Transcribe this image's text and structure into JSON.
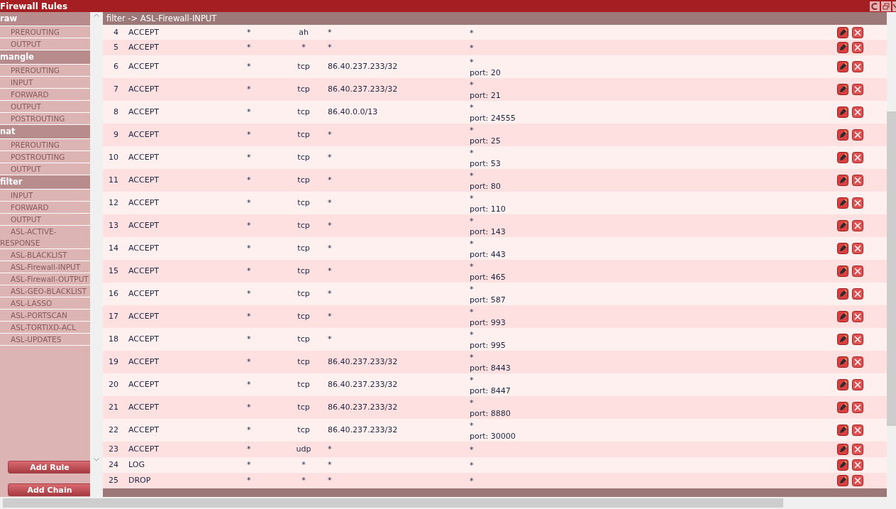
{
  "window": {
    "title": "Firewall Rules"
  },
  "sidebar": {
    "groups": [
      {
        "name": "raw",
        "items": [
          "PREROUTING",
          "OUTPUT"
        ]
      },
      {
        "name": "mangle",
        "items": [
          "PREROUTING",
          "INPUT",
          "FORWARD",
          "OUTPUT",
          "POSTROUTING"
        ]
      },
      {
        "name": "nat",
        "items": [
          "PREROUTING",
          "POSTROUTING",
          "OUTPUT"
        ]
      },
      {
        "name": "filter",
        "items": [
          "INPUT",
          "FORWARD",
          "OUTPUT",
          "ASL-ACTIVE-RESPONSE",
          "ASL-BLACKLIST",
          "ASL-Firewall-INPUT",
          "ASL-Firewall-OUTPUT",
          "ASL-GEO-BLACKLIST",
          "ASL-LASSO",
          "ASL-PORTSCAN",
          "ASL-TORTIXD-ACL",
          "ASL-UPDATES"
        ]
      }
    ],
    "buttons": [
      "Add Rule",
      "Add Chain"
    ]
  },
  "breadcrumb": "filter -> ASL-Firewall-INPUT",
  "rules": [
    {
      "num": "4",
      "target": "ACCEPT",
      "column_3": "*",
      "protocol": "ah",
      "source": "*",
      "destination": "*"
    },
    {
      "num": "5",
      "target": "ACCEPT",
      "column_3": "*",
      "protocol": "*",
      "source": "*",
      "destination": "*"
    },
    {
      "num": "6",
      "target": "ACCEPT",
      "column_3": "*",
      "protocol": "tcp",
      "source": "86.40.237.233/32",
      "destination": "*",
      "port": "port: 20"
    },
    {
      "num": "7",
      "target": "ACCEPT",
      "column_3": "*",
      "protocol": "tcp",
      "source": "86.40.237.233/32",
      "destination": "*",
      "port": "port: 21"
    },
    {
      "num": "8",
      "target": "ACCEPT",
      "column_3": "*",
      "protocol": "tcp",
      "source": "86.40.0.0/13",
      "destination": "*",
      "port": "port: 24555"
    },
    {
      "num": "9",
      "target": "ACCEPT",
      "column_3": "*",
      "protocol": "tcp",
      "source": "*",
      "destination": "*",
      "port": "port: 25"
    },
    {
      "num": "10",
      "target": "ACCEPT",
      "column_3": "*",
      "protocol": "tcp",
      "source": "*",
      "destination": "*",
      "port": "port: 53"
    },
    {
      "num": "11",
      "target": "ACCEPT",
      "column_3": "*",
      "protocol": "tcp",
      "source": "*",
      "destination": "*",
      "port": "port: 80"
    },
    {
      "num": "12",
      "target": "ACCEPT",
      "column_3": "*",
      "protocol": "tcp",
      "source": "*",
      "destination": "*",
      "port": "port: 110"
    },
    {
      "num": "13",
      "target": "ACCEPT",
      "column_3": "*",
      "protocol": "tcp",
      "source": "*",
      "destination": "*",
      "port": "port: 143"
    },
    {
      "num": "14",
      "target": "ACCEPT",
      "column_3": "*",
      "protocol": "tcp",
      "source": "*",
      "destination": "*",
      "port": "port: 443"
    },
    {
      "num": "15",
      "target": "ACCEPT",
      "column_3": "*",
      "protocol": "tcp",
      "source": "*",
      "destination": "*",
      "port": "port: 465"
    },
    {
      "num": "16",
      "target": "ACCEPT",
      "column_3": "*",
      "protocol": "tcp",
      "source": "*",
      "destination": "*",
      "port": "port: 587"
    },
    {
      "num": "17",
      "target": "ACCEPT",
      "column_3": "*",
      "protocol": "tcp",
      "source": "*",
      "destination": "*",
      "port": "port: 993"
    },
    {
      "num": "18",
      "target": "ACCEPT",
      "column_3": "*",
      "protocol": "tcp",
      "source": "*",
      "destination": "*",
      "port": "port: 995"
    },
    {
      "num": "19",
      "target": "ACCEPT",
      "column_3": "*",
      "protocol": "tcp",
      "source": "86.40.237.233/32",
      "destination": "*",
      "port": "port: 8443"
    },
    {
      "num": "20",
      "target": "ACCEPT",
      "column_3": "*",
      "protocol": "tcp",
      "source": "86.40.237.233/32",
      "destination": "*",
      "port": "port: 8447"
    },
    {
      "num": "21",
      "target": "ACCEPT",
      "column_3": "*",
      "protocol": "tcp",
      "source": "86.40.237.233/32",
      "destination": "*",
      "port": "port: 8880"
    },
    {
      "num": "22",
      "target": "ACCEPT",
      "column_3": "*",
      "protocol": "tcp",
      "source": "86.40.237.233/32",
      "destination": "*",
      "port": "port: 30000"
    },
    {
      "num": "23",
      "target": "ACCEPT",
      "column_3": "*",
      "protocol": "udp",
      "source": "*",
      "destination": "*"
    },
    {
      "num": "24",
      "target": "LOG",
      "column_3": "*",
      "protocol": "*",
      "source": "*",
      "destination": "*"
    },
    {
      "num": "25",
      "target": "DROP",
      "column_3": "*",
      "protocol": "*",
      "source": "*",
      "destination": "*"
    }
  ]
}
